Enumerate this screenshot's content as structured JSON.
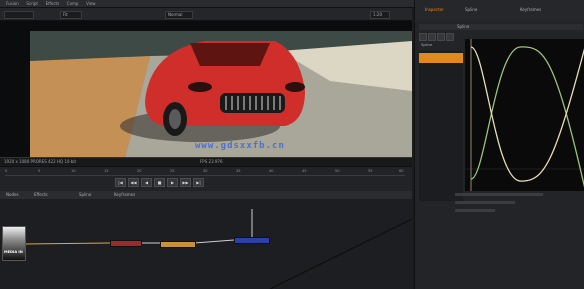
{
  "menubar": {
    "items": [
      "Fusion",
      "Script",
      "Effects",
      "Comp",
      "View"
    ]
  },
  "viewer": {
    "watermark": "www.gdsxxfb.cn",
    "toolbar": {
      "zoom": "Fit",
      "view_mode": "Normal",
      "frame_label": "1:20"
    },
    "status": {
      "left": "1920 x 1080 PRORES 422 HQ  10-bit",
      "center": "FPS 23.976",
      "right": ""
    }
  },
  "timeline": {
    "ticks": [
      "0",
      "5",
      "10",
      "15",
      "20",
      "25",
      "30",
      "35",
      "40",
      "45",
      "50",
      "55",
      "60"
    ],
    "transport": [
      "|◀",
      "◀◀",
      "◀",
      "■",
      "▶",
      "▶▶",
      "▶|"
    ]
  },
  "node_tabs": [
    "Nodes",
    "Effects",
    "Spline",
    "Keyframes"
  ],
  "nodes": {
    "loader_label": "MEDIA IN"
  },
  "right_panel": {
    "tabs": [
      "Inspector",
      "Spline",
      "Keyframes"
    ],
    "spline_header": "Spline",
    "list_label": "Spline"
  },
  "colors": {
    "accent_orange": "#e08a1e",
    "node_red": "#9b2b2b",
    "node_gold": "#c6923a",
    "node_blue": "#2f3fa8",
    "curve_green": "#9bc37d",
    "curve_cream": "#e9dfb4"
  }
}
